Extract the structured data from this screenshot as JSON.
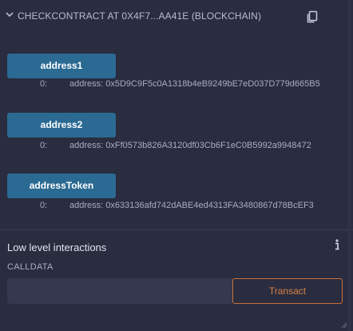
{
  "header": {
    "title": "CHECKCONTRACT AT 0X4F7...AA41E (BLOCKCHAIN)",
    "icons": {
      "expand": "chevron-down-icon",
      "copy": "copy-icon"
    }
  },
  "functions": [
    {
      "label": "address1",
      "result_index": "0:",
      "result_value": "address: 0x5D9C9F5c0A1318b4eB9249bE7eD037D779d665B5"
    },
    {
      "label": "address2",
      "result_index": "0:",
      "result_value": "address: 0xFf0573b826A3120df03Cb6F1eC0B5992a9948472"
    },
    {
      "label": "addressToken",
      "result_index": "0:",
      "result_value": "address: 0x633136afd742dABE4ed4313FA3480867d78BcEF3"
    }
  ],
  "low_level": {
    "title": "Low level interactions",
    "calldata_label": "CALLDATA",
    "calldata_value": "",
    "calldata_placeholder": "",
    "transact_label": "Transact",
    "info_icon": "info-icon"
  },
  "colors": {
    "background": "#2a2c3f",
    "function_button": "#2a6a93",
    "transact_border": "#c9723a",
    "input_background": "#35384e"
  }
}
